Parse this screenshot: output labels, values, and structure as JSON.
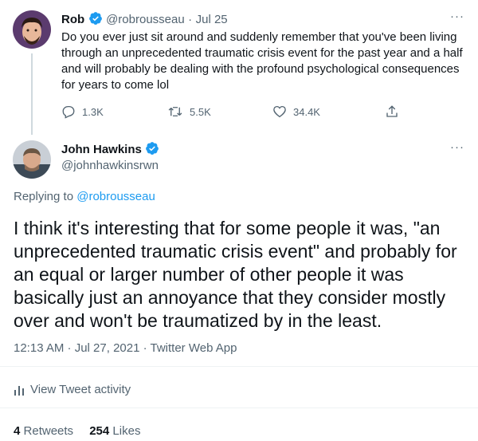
{
  "parent_tweet": {
    "name": "Rob",
    "handle": "@robrousseau",
    "separator": "·",
    "date": "Jul 25",
    "more": "···",
    "text_lines": [
      "Do you ever just sit around and suddenly remember that you've been living",
      "through an unprecedented traumatic crisis event for the past year and a half",
      "and will probably be dealing with the profound psychological consequences",
      "for years to come lol"
    ],
    "actions": {
      "replies": "1.3K",
      "retweets": "5.5K",
      "likes": "34.4K"
    }
  },
  "main_tweet": {
    "name": "John Hawkins",
    "handle": "@johnhawkinsrwn",
    "more": "···",
    "replying_prefix": "Replying to",
    "replying_handle": "@robrousseau",
    "text_lines": [
      "I think it's interesting that for some people it was, \"an",
      "unprecedented traumatic crisis event\" and probably for",
      "an equal or larger number of other people it was",
      "basically just an annoyance that they consider mostly",
      "over and won't be traumatized by in the least."
    ],
    "timestamp": "12:13 AM · Jul 27, 2021 · Twitter Web App",
    "activity_label": "View Tweet activity",
    "retweets_count": "4",
    "retweets_label": "Retweets",
    "likes_count": "254",
    "likes_label": "Likes"
  },
  "colors": {
    "accent": "#1d9bf0",
    "secondary_text": "#536471",
    "primary_text": "#0f1419"
  }
}
